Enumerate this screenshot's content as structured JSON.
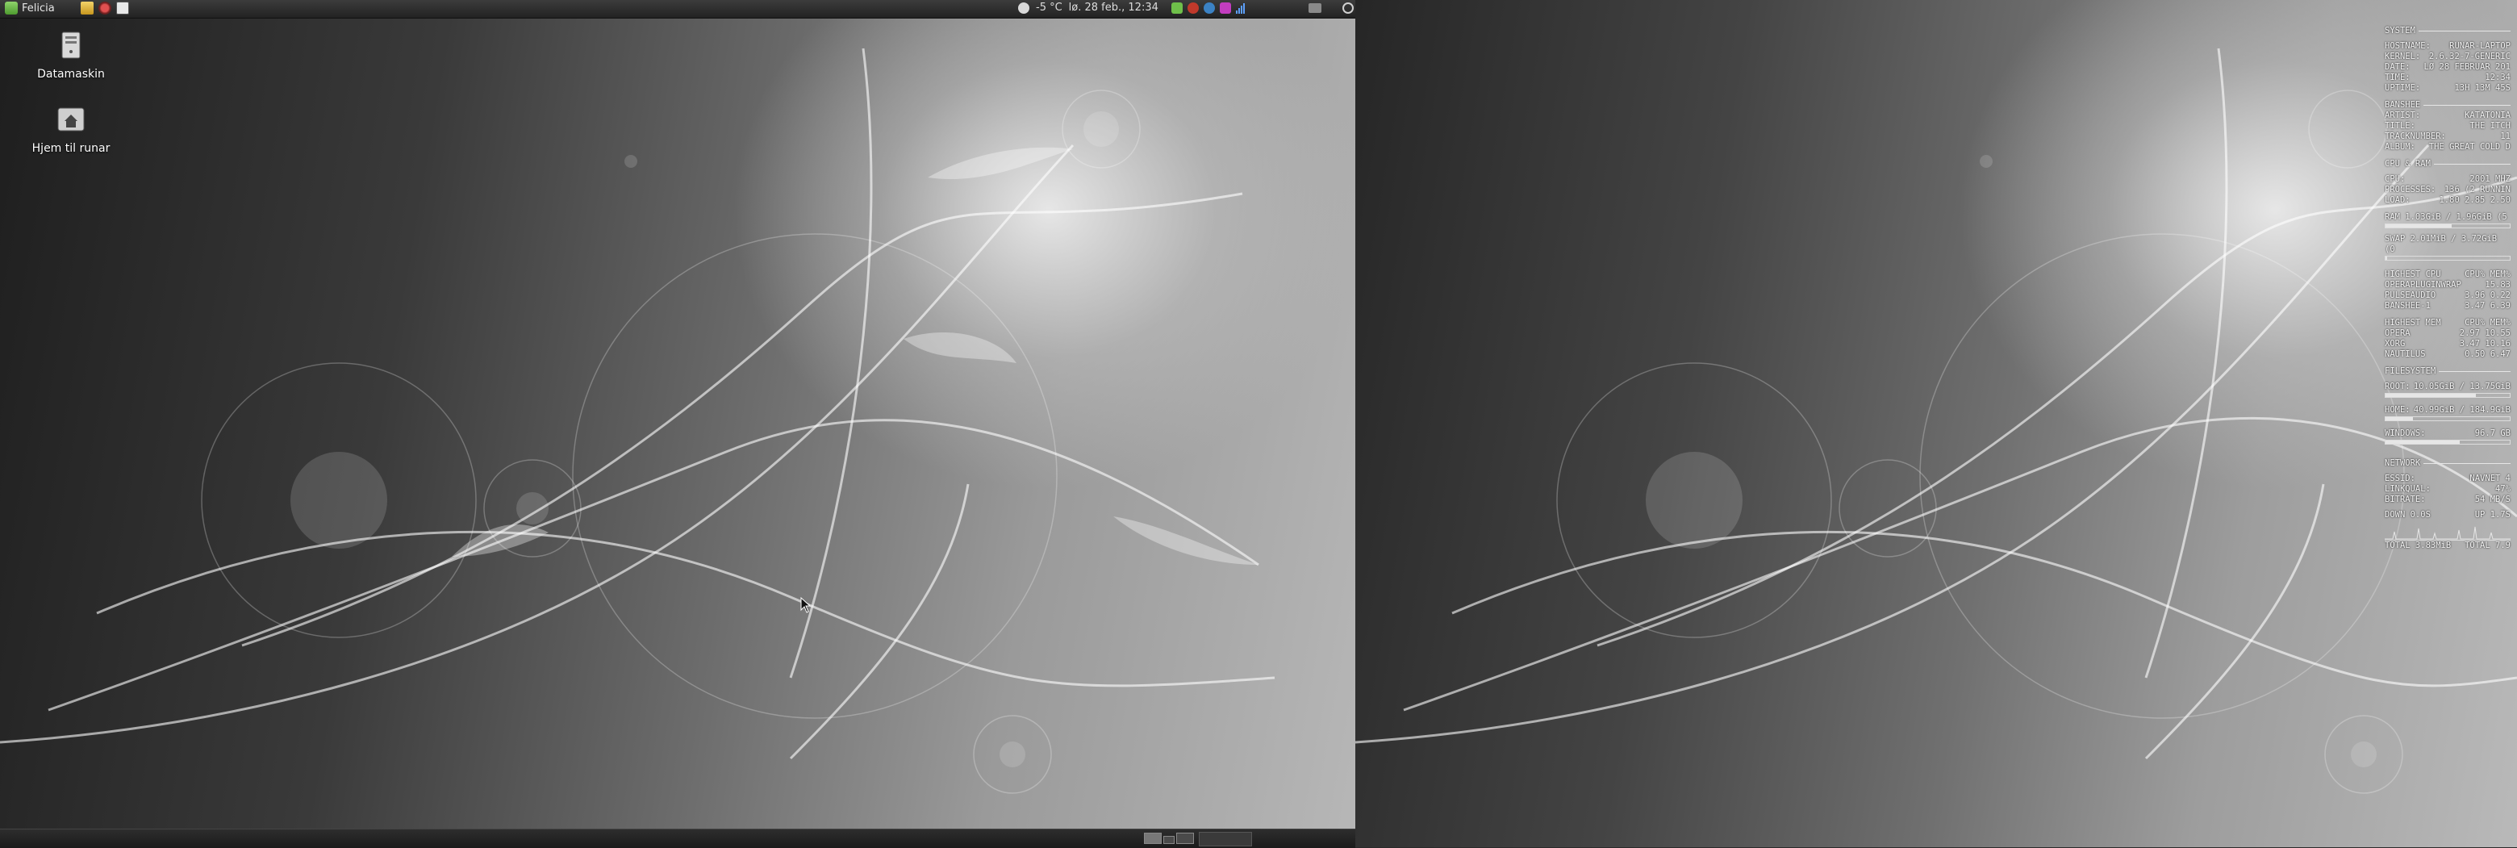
{
  "top_panel": {
    "menu_label": "Felicia",
    "weather": "-5 °C",
    "datetime": "lø. 28 feb., 12:34"
  },
  "desktop_icons": [
    {
      "label": "Datamaskin",
      "icon": "computer-icon"
    },
    {
      "label": "Hjem til runar",
      "icon": "home-folder-icon"
    }
  ],
  "conky": {
    "system_header": "SYSTEM",
    "system": [
      {
        "k": "HOSTNAME:",
        "v": "RUNAR-LAPTOP"
      },
      {
        "k": "KERNEL:",
        "v": "2.6.32-7-GENERIC"
      },
      {
        "k": "DATE:",
        "v": "LØ 28 FEBRUAR 201"
      },
      {
        "k": "TIME:",
        "v": "12:34"
      },
      {
        "k": "UPTIME:",
        "v": "13H 13M 45S"
      }
    ],
    "banshee_header": "BANSHEE",
    "banshee": [
      {
        "k": "ARTIST:",
        "v": "KATATONIA"
      },
      {
        "k": "TITLE:",
        "v": "THE ITCH"
      },
      {
        "k": "TRACKNUMBER:",
        "v": "11"
      },
      {
        "k": "ALBUM:",
        "v": "THE GREAT COLD D"
      }
    ],
    "cpuram_header": "CPU & RAM",
    "cpuram": [
      {
        "k": "CPU:",
        "v": "2001 MHZ"
      },
      {
        "k": "PROCESSES:",
        "v": "136 (2 RUNNIN"
      },
      {
        "k": "LOAD:",
        "v": "1.80 2.85 2.50"
      }
    ],
    "ram": {
      "label": "RAM 1.03GiB / 1.96GiB (5",
      "percent": 53
    },
    "swap": {
      "label": "SWAP 2.01MiB / 3.72GiB (0",
      "percent": 1
    },
    "highest_cpu": {
      "header": {
        "k": "HIGHEST CPU",
        "v": "CPU% MEM%"
      },
      "rows": [
        {
          "k": "OPERAPLUGINWRAP",
          "v": "15.83"
        },
        {
          "k": "PULSEAUDIO",
          "v": "3.96  0.22"
        },
        {
          "k": "BANSHEE-1",
          "v": "3.47  6.39"
        }
      ]
    },
    "highest_mem": {
      "header": {
        "k": "HIGHEST MEM",
        "v": "CPU% MEM%"
      },
      "rows": [
        {
          "k": "OPERA",
          "v": "2.97 10.55"
        },
        {
          "k": "XORG",
          "v": "3.47 10.16"
        },
        {
          "k": "NAUTILUS",
          "v": "0.50  6.47"
        }
      ]
    },
    "filesystem_header": "FILESYSTEM",
    "filesystem": [
      {
        "k": "ROOT:",
        "v": "10.05GiB / 13.75GiB",
        "percent": 73
      },
      {
        "k": "HOME:",
        "v": "40.99GiB / 184.9GiB",
        "percent": 22
      },
      {
        "k": "WINDOWS:",
        "v": "96.7 GB",
        "percent": 60
      }
    ],
    "network_header": "NETWORK",
    "network": [
      {
        "k": "ESSID:",
        "v": "NAVNET 4"
      },
      {
        "k": "LINKQUAL:",
        "v": "47%"
      },
      {
        "k": "BITRATE:",
        "v": "54 MB/S"
      }
    ],
    "traffic": {
      "down": "DOWN 0.0S",
      "up": "UP 1.7S"
    },
    "totals": {
      "down": "TOTAL 3.83MiB",
      "up": "TOTAL 7.9"
    }
  }
}
